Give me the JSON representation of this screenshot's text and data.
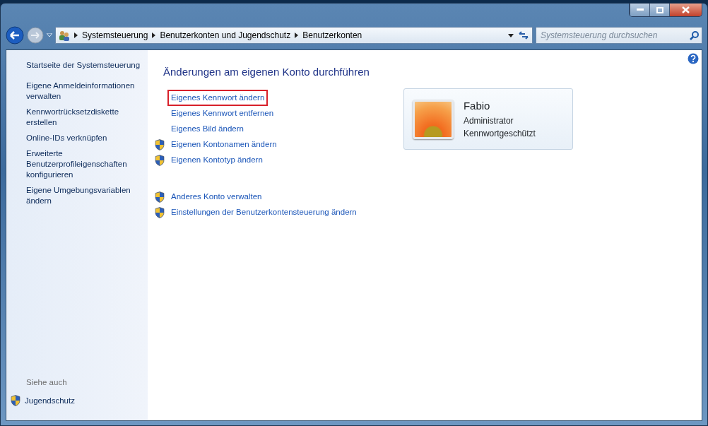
{
  "address_bar": {
    "crumbs": [
      "Systemsteuerung",
      "Benutzerkonten und Jugendschutz",
      "Benutzerkonten"
    ]
  },
  "search": {
    "placeholder": "Systemsteuerung durchsuchen"
  },
  "sidebar": {
    "items": [
      {
        "label": "Startseite der Systemsteuerung"
      },
      {
        "label": "Eigene Anmeldeinformationen verwalten"
      },
      {
        "label": "Kennwortrücksetzdiskette erstellen"
      },
      {
        "label": "Online-IDs verknüpfen"
      },
      {
        "label": "Erweiterte Benutzerprofileigenschaften konfigurieren"
      },
      {
        "label": "Eigene Umgebungsvariablen ändern"
      }
    ],
    "see_also_heading": "Siehe auch",
    "see_also": [
      {
        "label": "Jugendschutz",
        "shield": true
      }
    ]
  },
  "main": {
    "heading": "Änderungen am eigenen Konto durchführen",
    "groups": [
      [
        {
          "label": "Eigenes Kennwort ändern",
          "shield": false,
          "highlighted": true
        },
        {
          "label": "Eigenes Kennwort entfernen",
          "shield": false,
          "highlighted": false
        },
        {
          "label": "Eigenes Bild ändern",
          "shield": false,
          "highlighted": false
        },
        {
          "label": "Eigenen Kontonamen ändern",
          "shield": true,
          "highlighted": false
        },
        {
          "label": "Eigenen Kontotyp ändern",
          "shield": true,
          "highlighted": false
        }
      ],
      [
        {
          "label": "Anderes Konto verwalten",
          "shield": true,
          "highlighted": false
        },
        {
          "label": "Einstellungen der Benutzerkontensteuerung ändern",
          "shield": true,
          "highlighted": false
        }
      ]
    ]
  },
  "account": {
    "name": "Fabio",
    "type": "Administrator",
    "status": "Kennwortgeschützt"
  }
}
